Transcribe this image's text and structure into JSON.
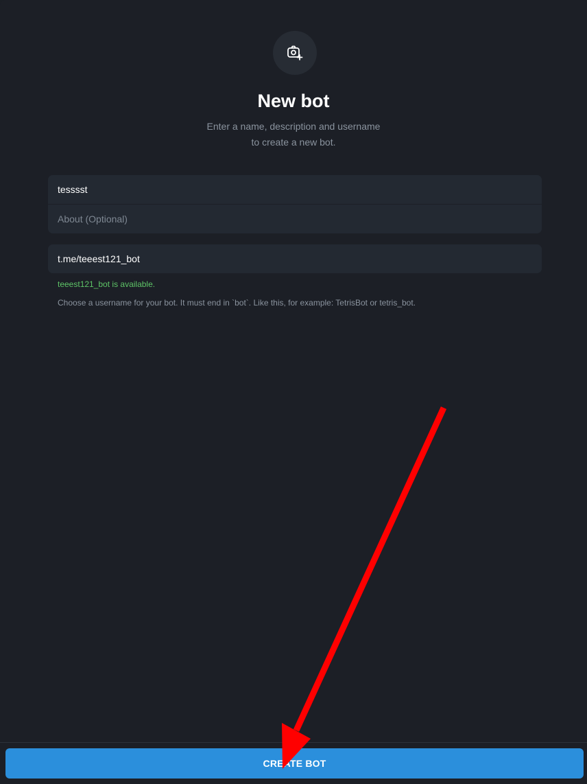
{
  "header": {
    "avatar_icon": "camera-add-icon",
    "title": "New bot",
    "subtitle_line1": "Enter a name, description and username",
    "subtitle_line2": "to create a new bot."
  },
  "form": {
    "name_value": "tesssst",
    "about_placeholder": "About (Optional)",
    "username_value": "t.me/teeest121_bot",
    "availability": "teeest121_bot is available.",
    "hint": "Choose a username for your bot. It must end in `bot`. Like this, for example: TetrisBot or tetris_bot."
  },
  "footer": {
    "create_label": "CREATE BOT"
  },
  "annotation": {
    "icon": "red-arrow-icon",
    "color": "#ff0000"
  },
  "colors": {
    "background": "#1c1f26",
    "field": "#232932",
    "accent": "#2b8fdc",
    "success": "#5ec467",
    "muted": "#8a939e"
  }
}
